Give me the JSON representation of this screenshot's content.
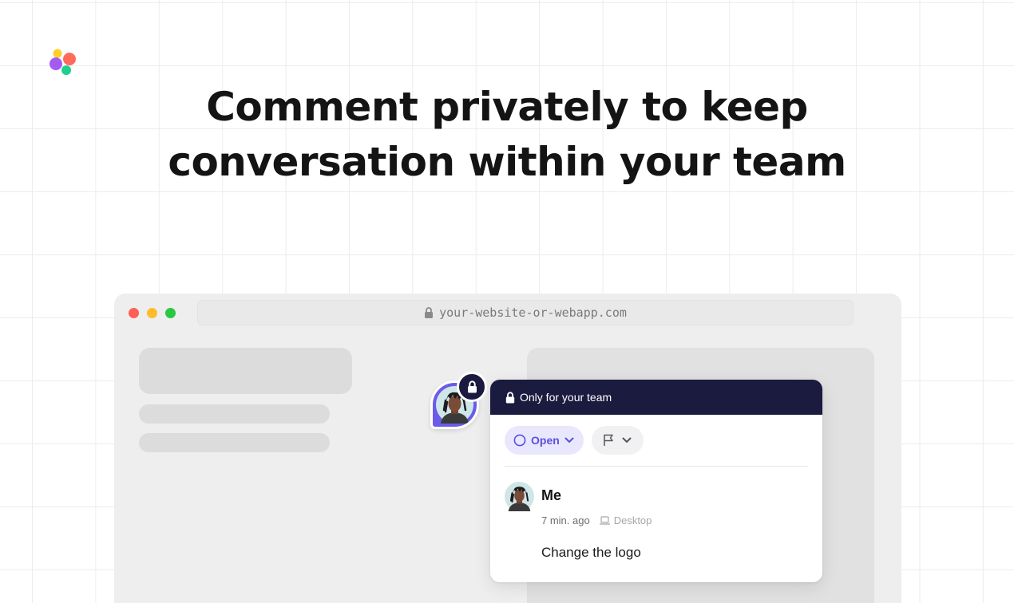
{
  "headline": {
    "line1": "Comment privately to keep",
    "line2": "conversation within your team"
  },
  "browser": {
    "url": "your-website-or-webapp.com"
  },
  "comment_card": {
    "header_label": "Only for your team",
    "status_label": "Open",
    "author": "Me",
    "timestamp": "7 min. ago",
    "device": "Desktop",
    "text": "Change the logo"
  },
  "colors": {
    "accent": "#5b4fe0",
    "header_bg": "#1b1a3f",
    "pin_bg": "#6a5ce8"
  },
  "icons": [
    "brand-logo-icon",
    "lock-icon",
    "circle-icon",
    "chevron-down-icon",
    "flag-icon",
    "laptop-icon"
  ]
}
